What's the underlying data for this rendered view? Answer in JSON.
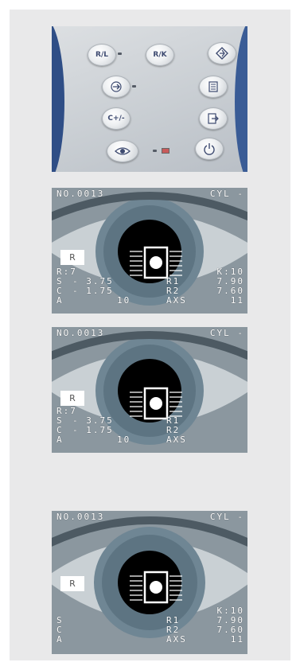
{
  "panel": {
    "buttons": {
      "rl": "R/L",
      "rk": "R/K",
      "cyl_sign": "C+/-"
    },
    "icons": [
      "diamond-arrow-icon",
      "arrow-right-icon",
      "document-list-icon",
      "document-export-icon",
      "eye-icon",
      "power-icon"
    ]
  },
  "screens": [
    {
      "header_left": "NO.0013",
      "header_right": "CYL -",
      "eye": "R",
      "r_label": "R:7",
      "k_label": "K:10",
      "rows": [
        {
          "label": "S",
          "value": "- 3.75",
          "klabel": "R1",
          "kvalue": "7.90"
        },
        {
          "label": "C",
          "value": "- 1.75",
          "klabel": "R2",
          "kvalue": "7.60"
        },
        {
          "label": "A",
          "value": "10",
          "klabel": "AXS",
          "kvalue": "11"
        }
      ]
    },
    {
      "header_left": "NO.0013",
      "header_right": "CYL -",
      "eye": "R",
      "r_label": "R:7",
      "k_label": "",
      "rows": [
        {
          "label": "S",
          "value": "- 3.75",
          "klabel": "R1",
          "kvalue": ""
        },
        {
          "label": "C",
          "value": "- 1.75",
          "klabel": "R2",
          "kvalue": ""
        },
        {
          "label": "A",
          "value": "10",
          "klabel": "AXS",
          "kvalue": ""
        }
      ]
    },
    {
      "header_left": "NO.0013",
      "header_right": "CYL -",
      "eye": "R",
      "r_label": "",
      "k_label": "K:10",
      "rows": [
        {
          "label": "S",
          "value": "",
          "klabel": "R1",
          "kvalue": "7.90"
        },
        {
          "label": "C",
          "value": "",
          "klabel": "R2",
          "kvalue": "7.60"
        },
        {
          "label": "A",
          "value": "",
          "klabel": "AXS",
          "kvalue": "11"
        }
      ]
    }
  ]
}
